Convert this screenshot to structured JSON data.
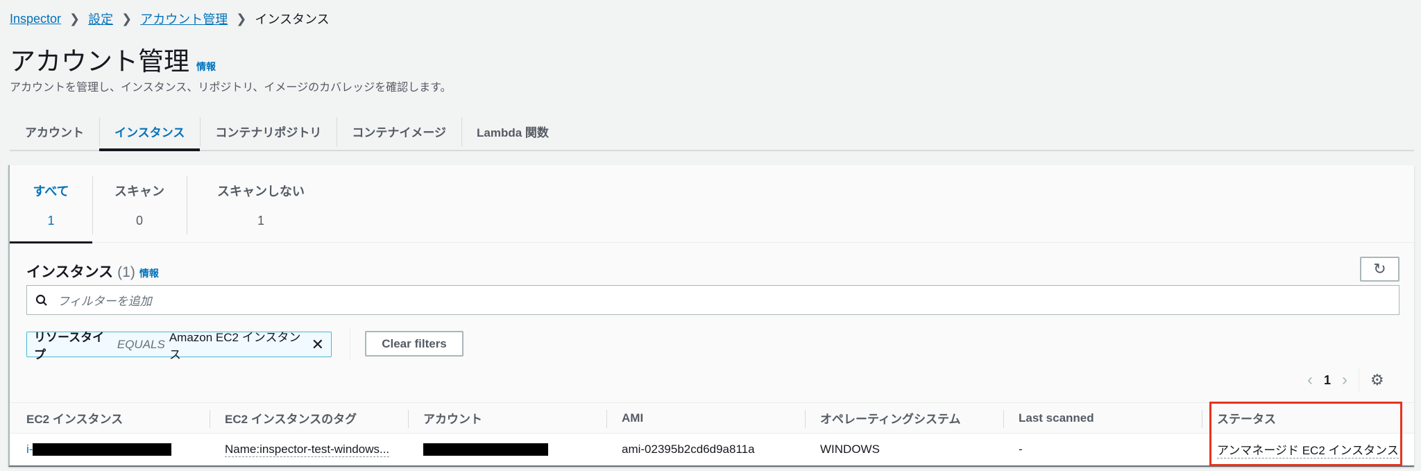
{
  "breadcrumb": {
    "items": [
      "Inspector",
      "設定",
      "アカウント管理"
    ],
    "current": "インスタンス"
  },
  "page": {
    "title": "アカウント管理",
    "info": "情報",
    "description": "アカウントを管理し、インスタンス、リポジトリ、イメージのカバレッジを確認します。"
  },
  "tabs": [
    "アカウント",
    "インスタンス",
    "コンテナリポジトリ",
    "コンテナイメージ",
    "Lambda 関数"
  ],
  "segments": [
    {
      "label": "すべて",
      "count": "1"
    },
    {
      "label": "スキャン",
      "count": "0"
    },
    {
      "label": "スキャンしない",
      "count": "1"
    }
  ],
  "section": {
    "title": "インスタンス",
    "count": "(1)",
    "info": "情報"
  },
  "search": {
    "placeholder": "フィルターを追加"
  },
  "filter_chip": {
    "key": "リソースタイプ",
    "op": "EQUALS",
    "value": "Amazon EC2 インスタンス"
  },
  "clear_filters": "Clear filters",
  "pagination": {
    "page": "1"
  },
  "table": {
    "headers": [
      "EC2 インスタンス",
      "EC2 インスタンスのタグ",
      "アカウント",
      "AMI",
      "オペレーティングシステム",
      "Last scanned",
      "ステータス"
    ],
    "rows": [
      {
        "instance_prefix": "i-",
        "tag": "Name:inspector-test-windows...",
        "ami": "ami-02395b2cd6d9a811a",
        "os": "WINDOWS",
        "last_scanned": "-",
        "status": "アンマネージド EC2 インスタンス"
      }
    ]
  },
  "colors": {
    "link": "#0073bb",
    "highlight": "#e8331c"
  }
}
